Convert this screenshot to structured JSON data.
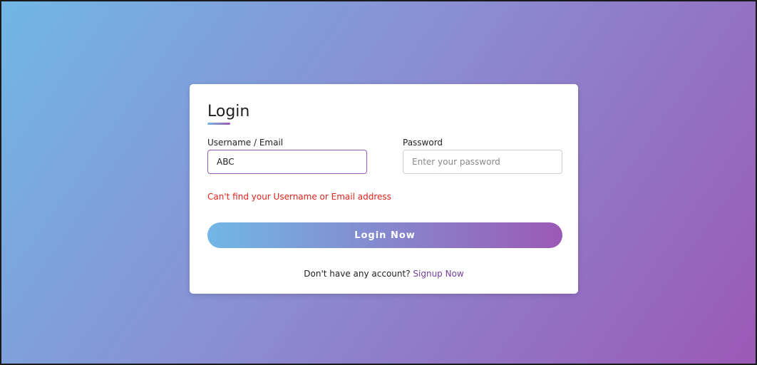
{
  "login_form": {
    "title": "Login",
    "username": {
      "label": "Username / Email",
      "value": "ABC"
    },
    "password": {
      "label": "Password",
      "placeholder": "Enter your password",
      "value": ""
    },
    "error_message": "Can't find your Username or Email address",
    "submit_label": "Login Now",
    "signup_prompt": "Don't have any account?",
    "signup_link": "Signup Now"
  },
  "colors": {
    "gradient_start": "#71b7e6",
    "gradient_end": "#9b59b6",
    "error": "#e0231d",
    "link": "#6f3f9b"
  }
}
